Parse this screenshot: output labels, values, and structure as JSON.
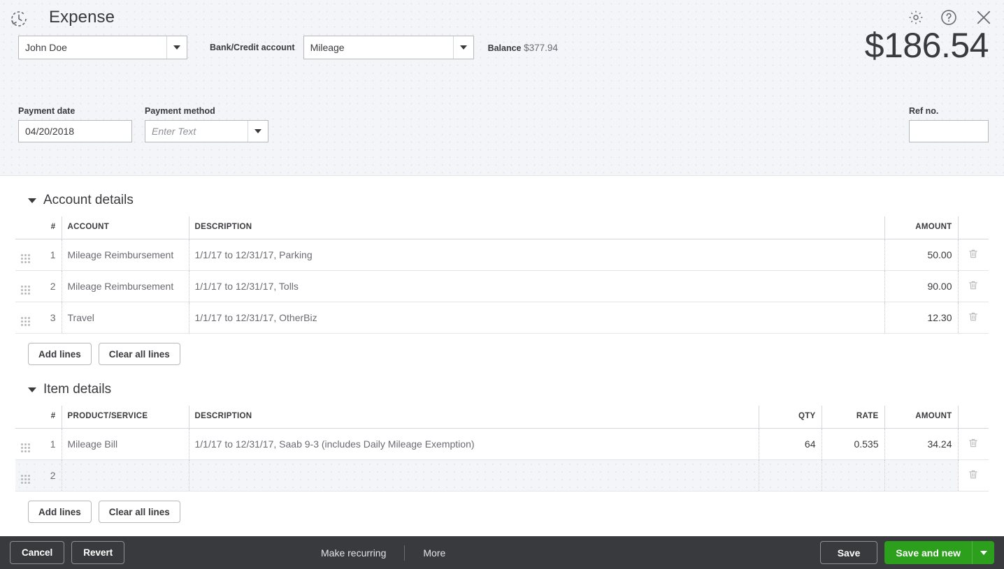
{
  "header": {
    "logo_icon": "recurring-clock-icon",
    "title": "Expense",
    "amount": "$186.54",
    "gear_icon": "gear-icon",
    "help_icon": "help-icon",
    "close_icon": "close-icon",
    "payee": {
      "value": "John Doe",
      "placeholder": ""
    },
    "bank_account": {
      "label": "Bank/Credit account",
      "value": "Mileage",
      "placeholder": ""
    },
    "balance": {
      "label": "Balance",
      "value": "$377.94"
    },
    "payment_date": {
      "label": "Payment date",
      "value": "04/20/2018"
    },
    "payment_method": {
      "label": "Payment method",
      "value": "",
      "placeholder": "Enter Text"
    },
    "ref_no": {
      "label": "Ref no.",
      "value": "",
      "placeholder": ""
    }
  },
  "account_details": {
    "title": "Account details",
    "columns": [
      "#",
      "ACCOUNT",
      "DESCRIPTION",
      "AMOUNT"
    ],
    "rows": [
      {
        "num": "1",
        "account": "Mileage Reimbursement",
        "description": "1/1/17 to 12/31/17, Parking",
        "amount": "50.00"
      },
      {
        "num": "2",
        "account": "Mileage Reimbursement",
        "description": "1/1/17 to 12/31/17, Tolls",
        "amount": "90.00"
      },
      {
        "num": "3",
        "account": "Travel",
        "description": "1/1/17 to 12/31/17, OtherBiz",
        "amount": "12.30"
      }
    ],
    "add_lines_label": "Add lines",
    "clear_all_lines_label": "Clear all lines"
  },
  "item_details": {
    "title": "Item details",
    "columns": [
      "#",
      "PRODUCT/SERVICE",
      "DESCRIPTION",
      "QTY",
      "RATE",
      "AMOUNT"
    ],
    "rows": [
      {
        "num": "1",
        "product": "Mileage Bill",
        "description": "1/1/17 to 12/31/17, Saab 9-3 (includes Daily Mileage Exemption)",
        "qty": "64",
        "rate": "0.535",
        "amount": "34.24"
      },
      {
        "num": "2",
        "product": "",
        "description": "",
        "qty": "",
        "rate": "",
        "amount": ""
      }
    ],
    "add_lines_label": "Add lines",
    "clear_all_lines_label": "Clear all lines"
  },
  "footer": {
    "cancel_label": "Cancel",
    "revert_label": "Revert",
    "make_recurring_label": "Make recurring",
    "more_label": "More",
    "save_label": "Save",
    "save_and_new_label": "Save and new",
    "save_caret_icon": "chevron-down-icon"
  },
  "colors": {
    "accent_green": "#2ca01c",
    "footer_bg": "#393a3d",
    "header_bg": "#f4f5f8"
  }
}
